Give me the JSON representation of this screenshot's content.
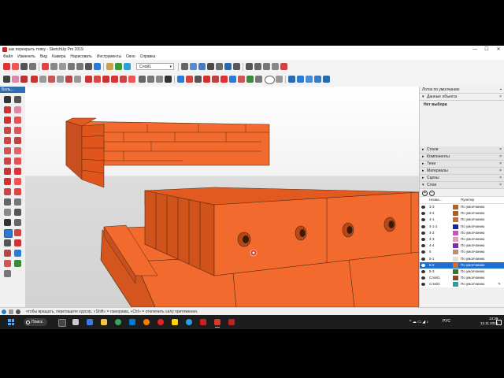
{
  "window": {
    "title": "как перекрыть топку - SketchUp Pro 2019",
    "controls": [
      "—",
      "☐",
      "✕"
    ]
  },
  "menu": [
    "Файл",
    "Изменить",
    "Вид",
    "Камера",
    "Нарисовать",
    "Инструменты",
    "Окно",
    "Справка"
  ],
  "toolbar": {
    "layer_dropdown": "Слой1"
  },
  "left_toolbar": {
    "header": "Боль..."
  },
  "tray": {
    "title": "Лоток по умолчанию",
    "entity_section": "Данные объекта",
    "selection": "Нет выбора",
    "sections": [
      "Стили",
      "Компоненты",
      "Тени",
      "Материалы",
      "Сцены",
      "Слои"
    ],
    "layers": {
      "col_name": "Назва...",
      "col_type": "Пунктир",
      "rows": [
        {
          "name": "3-3",
          "color": "#b5651d",
          "type": "По умолчанию"
        },
        {
          "name": "3-4",
          "color": "#b25b1f",
          "type": "По умолчанию"
        },
        {
          "name": "4-1",
          "color": "#c96b2f",
          "type": "По умолчанию"
        },
        {
          "name": "4-1-2",
          "color": "#1f1fb0",
          "type": "По умолчанию"
        },
        {
          "name": "4-2",
          "color": "#d24fc0",
          "type": "По умолчанию"
        },
        {
          "name": "4-3",
          "color": "#e79db8",
          "type": "По умолчанию"
        },
        {
          "name": "4-4",
          "color": "#7a2fb0",
          "type": "По умолчанию"
        },
        {
          "name": "5",
          "color": "#c28a7a",
          "type": "По умолчанию"
        },
        {
          "name": "5-1",
          "color": "#e0e0e0",
          "type": "По умолчанию"
        },
        {
          "name": "5-2",
          "color": "#d86a2c",
          "type": "По умолчанию"
        },
        {
          "name": "5-3",
          "color": "#2e7a2e",
          "type": "По умолчанию"
        },
        {
          "name": "Слой1",
          "color": "#8a4b1f",
          "type": "По умолчанию"
        },
        {
          "name": "Слой2",
          "color": "#2aa39a",
          "type": "По умолчанию"
        }
      ]
    }
  },
  "status": {
    "text": "чтобы вращать, перетащите курсор, «Shift» = панорама, «Ctrl» = отключить силу притяжения."
  },
  "taskbar": {
    "search": "Поиск",
    "lang": "РУС",
    "time": "14:39",
    "date": "12.11.2022"
  },
  "colors": {
    "brick": "#f26a2e",
    "brick_dark": "#c85020",
    "selection": "#1f6fd0"
  }
}
